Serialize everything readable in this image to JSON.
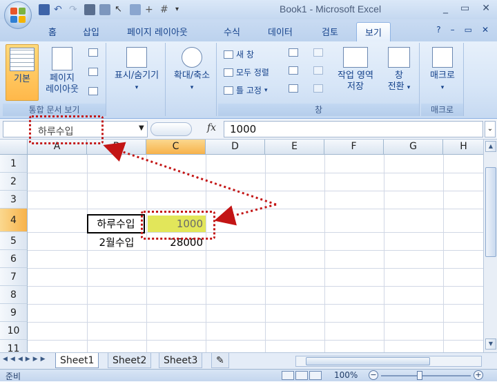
{
  "window": {
    "title": "Book1 - Microsoft Excel",
    "controls": [
      "_",
      "▭",
      "✕"
    ]
  },
  "tabs": [
    "홈",
    "삽입",
    "페이지 레이아웃",
    "수식",
    "데이터",
    "검토",
    "보기"
  ],
  "active_tab": "보기",
  "ribbon": {
    "group1": {
      "label": "통합 문서 보기",
      "normal": "기본",
      "page_layout_1": "페이지",
      "page_layout_2": "레이아웃"
    },
    "group2": {
      "show_hide": "표시/숨기기"
    },
    "group3": {
      "zoom": "확대/축소"
    },
    "group4": {
      "label": "창",
      "new_window": "새 창",
      "arrange_all": "모두 정렬",
      "freeze_panes": "틀 고정",
      "save_workspace_1": "작업 영역",
      "save_workspace_2": "저장",
      "switch_window_1": "창",
      "switch_window_2": "전환"
    },
    "group5": {
      "label": "매크로",
      "macros": "매크로"
    }
  },
  "formula_bar": {
    "name_box": "하루수입",
    "fx": "fx",
    "value": "1000"
  },
  "columns": [
    "A",
    "B",
    "C",
    "D",
    "E",
    "F",
    "G",
    "H"
  ],
  "selected_column": "C",
  "rows": [
    "1",
    "2",
    "3",
    "4",
    "5",
    "6",
    "7",
    "8",
    "9",
    "10",
    "11"
  ],
  "selected_row": "4",
  "cells": {
    "B4": "하루수입",
    "C4": "1000",
    "B5": "2월수입",
    "C5": "28000"
  },
  "sheets": [
    "Sheet1",
    "Sheet2",
    "Sheet3"
  ],
  "active_sheet": "Sheet1",
  "status": {
    "text": "준비",
    "zoom": "100%",
    "minus": "−",
    "plus": "+"
  },
  "colors": {
    "ribbon_accent": "#15428b",
    "selected_cell_fill": "#e2e65a",
    "annotation": "#c31515"
  }
}
